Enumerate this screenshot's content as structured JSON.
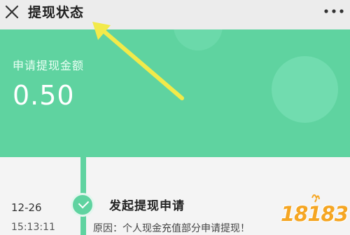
{
  "header": {
    "title": "提现状态"
  },
  "summary": {
    "amount_label": "申请提现金额",
    "amount_value": "0.50"
  },
  "timeline": {
    "steps": [
      {
        "date": "12-26",
        "time": "15:13:11",
        "title": "发起提现申请",
        "description": "原因：个人现金充值部分申请提现！"
      }
    ]
  },
  "watermark": {
    "text": "18183"
  },
  "colors": {
    "accent": "#5fd3a0",
    "annotation_arrow": "#f2ea4a",
    "watermark": "#f5a623"
  },
  "icons": {
    "close": "close-icon",
    "more": "more-dots-icon",
    "check": "check-icon"
  }
}
